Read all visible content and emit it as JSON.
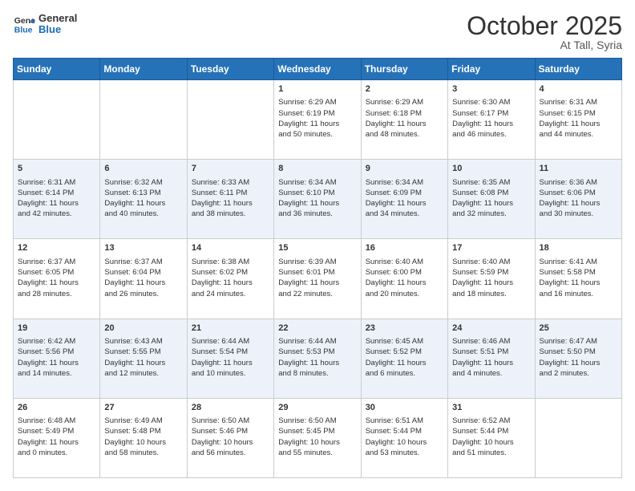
{
  "header": {
    "logo_general": "General",
    "logo_blue": "Blue",
    "month": "October 2025",
    "location": "At Tall, Syria"
  },
  "days_of_week": [
    "Sunday",
    "Monday",
    "Tuesday",
    "Wednesday",
    "Thursday",
    "Friday",
    "Saturday"
  ],
  "weeks": [
    [
      {
        "day": "",
        "info": ""
      },
      {
        "day": "",
        "info": ""
      },
      {
        "day": "",
        "info": ""
      },
      {
        "day": "1",
        "info": "Sunrise: 6:29 AM\nSunset: 6:19 PM\nDaylight: 11 hours\nand 50 minutes."
      },
      {
        "day": "2",
        "info": "Sunrise: 6:29 AM\nSunset: 6:18 PM\nDaylight: 11 hours\nand 48 minutes."
      },
      {
        "day": "3",
        "info": "Sunrise: 6:30 AM\nSunset: 6:17 PM\nDaylight: 11 hours\nand 46 minutes."
      },
      {
        "day": "4",
        "info": "Sunrise: 6:31 AM\nSunset: 6:15 PM\nDaylight: 11 hours\nand 44 minutes."
      }
    ],
    [
      {
        "day": "5",
        "info": "Sunrise: 6:31 AM\nSunset: 6:14 PM\nDaylight: 11 hours\nand 42 minutes."
      },
      {
        "day": "6",
        "info": "Sunrise: 6:32 AM\nSunset: 6:13 PM\nDaylight: 11 hours\nand 40 minutes."
      },
      {
        "day": "7",
        "info": "Sunrise: 6:33 AM\nSunset: 6:11 PM\nDaylight: 11 hours\nand 38 minutes."
      },
      {
        "day": "8",
        "info": "Sunrise: 6:34 AM\nSunset: 6:10 PM\nDaylight: 11 hours\nand 36 minutes."
      },
      {
        "day": "9",
        "info": "Sunrise: 6:34 AM\nSunset: 6:09 PM\nDaylight: 11 hours\nand 34 minutes."
      },
      {
        "day": "10",
        "info": "Sunrise: 6:35 AM\nSunset: 6:08 PM\nDaylight: 11 hours\nand 32 minutes."
      },
      {
        "day": "11",
        "info": "Sunrise: 6:36 AM\nSunset: 6:06 PM\nDaylight: 11 hours\nand 30 minutes."
      }
    ],
    [
      {
        "day": "12",
        "info": "Sunrise: 6:37 AM\nSunset: 6:05 PM\nDaylight: 11 hours\nand 28 minutes."
      },
      {
        "day": "13",
        "info": "Sunrise: 6:37 AM\nSunset: 6:04 PM\nDaylight: 11 hours\nand 26 minutes."
      },
      {
        "day": "14",
        "info": "Sunrise: 6:38 AM\nSunset: 6:02 PM\nDaylight: 11 hours\nand 24 minutes."
      },
      {
        "day": "15",
        "info": "Sunrise: 6:39 AM\nSunset: 6:01 PM\nDaylight: 11 hours\nand 22 minutes."
      },
      {
        "day": "16",
        "info": "Sunrise: 6:40 AM\nSunset: 6:00 PM\nDaylight: 11 hours\nand 20 minutes."
      },
      {
        "day": "17",
        "info": "Sunrise: 6:40 AM\nSunset: 5:59 PM\nDaylight: 11 hours\nand 18 minutes."
      },
      {
        "day": "18",
        "info": "Sunrise: 6:41 AM\nSunset: 5:58 PM\nDaylight: 11 hours\nand 16 minutes."
      }
    ],
    [
      {
        "day": "19",
        "info": "Sunrise: 6:42 AM\nSunset: 5:56 PM\nDaylight: 11 hours\nand 14 minutes."
      },
      {
        "day": "20",
        "info": "Sunrise: 6:43 AM\nSunset: 5:55 PM\nDaylight: 11 hours\nand 12 minutes."
      },
      {
        "day": "21",
        "info": "Sunrise: 6:44 AM\nSunset: 5:54 PM\nDaylight: 11 hours\nand 10 minutes."
      },
      {
        "day": "22",
        "info": "Sunrise: 6:44 AM\nSunset: 5:53 PM\nDaylight: 11 hours\nand 8 minutes."
      },
      {
        "day": "23",
        "info": "Sunrise: 6:45 AM\nSunset: 5:52 PM\nDaylight: 11 hours\nand 6 minutes."
      },
      {
        "day": "24",
        "info": "Sunrise: 6:46 AM\nSunset: 5:51 PM\nDaylight: 11 hours\nand 4 minutes."
      },
      {
        "day": "25",
        "info": "Sunrise: 6:47 AM\nSunset: 5:50 PM\nDaylight: 11 hours\nand 2 minutes."
      }
    ],
    [
      {
        "day": "26",
        "info": "Sunrise: 6:48 AM\nSunset: 5:49 PM\nDaylight: 11 hours\nand 0 minutes."
      },
      {
        "day": "27",
        "info": "Sunrise: 6:49 AM\nSunset: 5:48 PM\nDaylight: 10 hours\nand 58 minutes."
      },
      {
        "day": "28",
        "info": "Sunrise: 6:50 AM\nSunset: 5:46 PM\nDaylight: 10 hours\nand 56 minutes."
      },
      {
        "day": "29",
        "info": "Sunrise: 6:50 AM\nSunset: 5:45 PM\nDaylight: 10 hours\nand 55 minutes."
      },
      {
        "day": "30",
        "info": "Sunrise: 6:51 AM\nSunset: 5:44 PM\nDaylight: 10 hours\nand 53 minutes."
      },
      {
        "day": "31",
        "info": "Sunrise: 6:52 AM\nSunset: 5:44 PM\nDaylight: 10 hours\nand 51 minutes."
      },
      {
        "day": "",
        "info": ""
      }
    ]
  ]
}
